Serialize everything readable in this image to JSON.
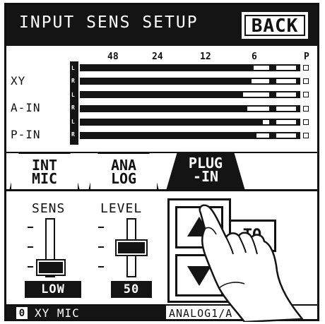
{
  "header": {
    "title": "INPUT SENS SETUP",
    "back_label": "BACK"
  },
  "meter": {
    "scale_labels": [
      "48",
      "24",
      "12",
      "6",
      "P"
    ],
    "rows": [
      {
        "label": "XY"
      },
      {
        "label": "A-IN"
      },
      {
        "label": "P-IN"
      }
    ],
    "channel_letters": [
      "L",
      "R",
      "L",
      "R",
      "L",
      "R"
    ],
    "levels": [
      0.79,
      0.78,
      0.74,
      0.76,
      0.83,
      0.8
    ]
  },
  "tabs": [
    {
      "line1": "INT",
      "line2": "MIC",
      "active": false
    },
    {
      "line1": "ANA",
      "line2": "LOG",
      "active": false
    },
    {
      "line1": "PLUG",
      "line2": "-IN",
      "active": true
    }
  ],
  "controls": {
    "sens": {
      "label": "SENS",
      "value": "LOW"
    },
    "level": {
      "label": "LEVEL",
      "value": "50"
    },
    "auto_label": "TO"
  },
  "footer": {
    "preset_number": "0",
    "input_name": "XY MIC",
    "source_name": "ANALOG1/A"
  },
  "colors": {
    "screen_dark": "#141414",
    "screen_light": "#ffffff"
  },
  "icons": [
    "up-arrow-icon",
    "down-arrow-icon",
    "pointing-hand-icon"
  ]
}
